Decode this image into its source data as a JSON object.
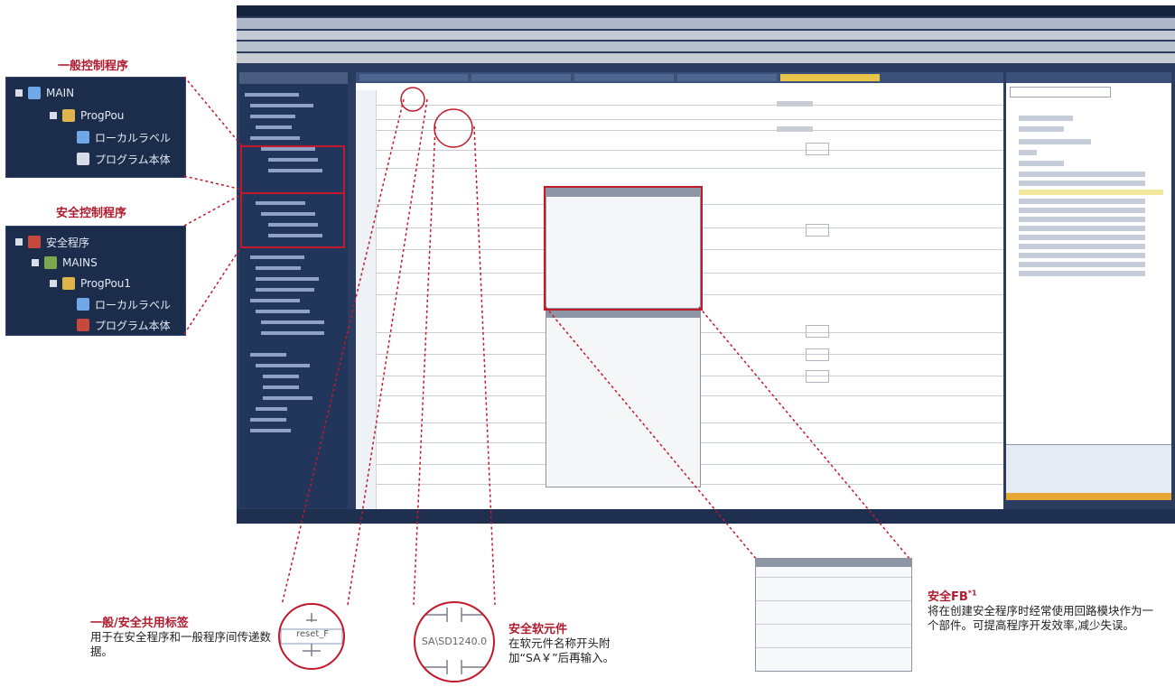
{
  "labels": {
    "general_program": "一般控制程序",
    "safety_program": "安全控制程序"
  },
  "general_tree": {
    "items": [
      {
        "label": "MAIN",
        "icon": "main-program-icon"
      },
      {
        "label": "ProgPou",
        "icon": "pou-folder-icon"
      },
      {
        "label": "ローカルラベル",
        "icon": "local-label-icon"
      },
      {
        "label": "プログラム本体",
        "icon": "program-body-icon"
      }
    ]
  },
  "safety_tree": {
    "items": [
      {
        "label": "安全程序",
        "icon": "safety-program-icon"
      },
      {
        "label": "MAINS",
        "icon": "main-safety-icon"
      },
      {
        "label": "ProgPou1",
        "icon": "pou-folder-icon"
      },
      {
        "label": "ローカルラベル",
        "icon": "local-label-icon"
      },
      {
        "label": "プログラム本体",
        "icon": "program-body-icon"
      }
    ]
  },
  "callouts": {
    "shared_label": {
      "title": "一般/安全共用标签",
      "body": "用于在安全程序和一般程序间传递数据。",
      "zoom_text": "reset_F"
    },
    "safety_device": {
      "title": "安全软元件",
      "body": "在软元件名称开头附加“SA￥”后再输入。",
      "zoom_text": "SA\\SD1240.0"
    },
    "safety_fb": {
      "title": "安全FB",
      "sup": "*1",
      "body": "将在创建安全程序时经常使用回路模块作为一个部件。可提高程序开发效率,减少失误。"
    }
  },
  "colors": {
    "accent_red": "#c2192c",
    "title_red": "#b01c2e",
    "panel_navy": "#1c2d4c"
  }
}
